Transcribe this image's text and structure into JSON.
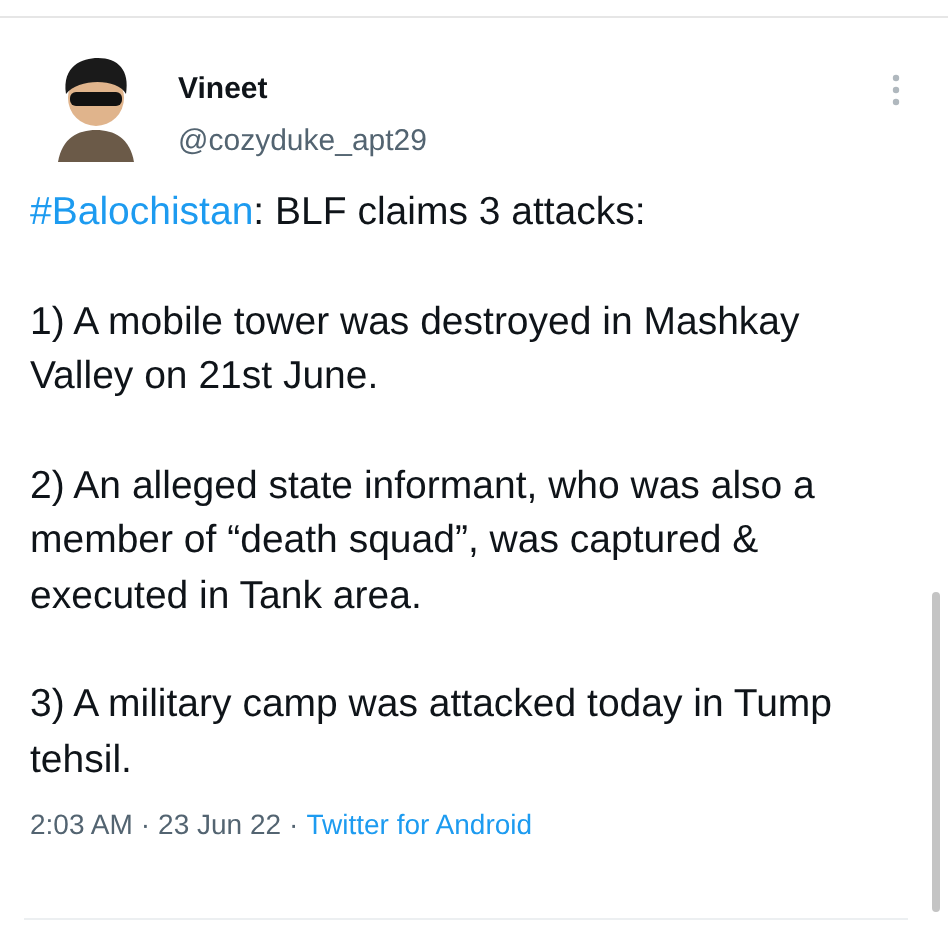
{
  "author": {
    "name": "Vineet",
    "handle": "@cozyduke_apt29"
  },
  "body": [
    {
      "hashtag": "#Balochistan",
      "text": ": BLF claims 3 attacks:"
    },
    {
      "text": "1) A mobile tower was destroyed in Mashkay Valley on 21st June."
    },
    {
      "text": "2) An alleged state informant, who was also a member of “death squad”, was captured & executed in Tank area."
    },
    {
      "text": "3) A military camp was attacked today in Tump tehsil."
    }
  ],
  "meta": {
    "time": "2:03 AM",
    "separator_1": "·",
    "date": "23 Jun 22",
    "separator_2": "·",
    "source": "Twitter for Android"
  }
}
